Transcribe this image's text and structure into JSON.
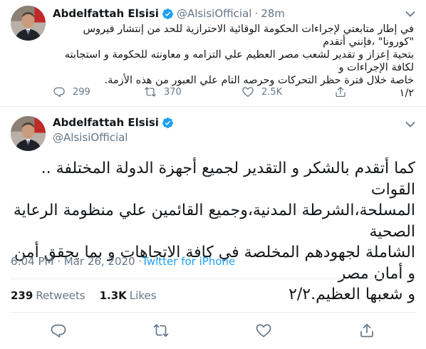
{
  "colors": {
    "accent": "#1da1f2",
    "secondary_text": "#657786",
    "border": "#e6ecf0"
  },
  "tweet1": {
    "display_name": "Abdelfattah Elsisi",
    "handle": "@AlsisiOfficial",
    "separator": "·",
    "time_ago": "28m",
    "lines": [
      "في إطار متابعتي لإجراءات الحكومة الوقائية الاحترازية للحد من إنتشار فيروس \"كورونا\" ،فإنني أتقدم",
      "بتحية إعزاز و تقدير لشعب مصر العظيم علي التزامه و معاونته للحكومة و استجابته لكافة الإجراءات و",
      "خاصة خلال فترة حظر التحركات وحرصه التام علي العبور من هذه الأزمة.",
      "١/٢"
    ],
    "replies": "299",
    "retweets": "370",
    "likes": "2.5K"
  },
  "tweet2": {
    "display_name": "Abdelfattah Elsisi",
    "handle": "@AlsisiOfficial",
    "lines": [
      "كما أتقدم بالشكر و التقدير لجميع أجهزة الدولة المختلفة .. القوات",
      "المسلحة،الشرطة المدنية،وجميع القائمين علي منظومة الرعاية الصحية",
      "الشاملة لجهودهم المخلصة في كافة الاتجاهات و بما يحقق أمن و أمان مصر",
      "و شعبها العظيم.٢/٢"
    ],
    "timestamp": "6:04 PM · Mar 26, 2020 · ",
    "source": "Twitter for iPhone",
    "retweets_count": "239",
    "retweets_label": "Retweets",
    "likes_count": "1.3K",
    "likes_label": "Likes"
  },
  "icons": [
    "verified-badge-icon",
    "chevron-down-icon",
    "reply-icon",
    "retweet-icon",
    "like-icon",
    "share-icon"
  ]
}
